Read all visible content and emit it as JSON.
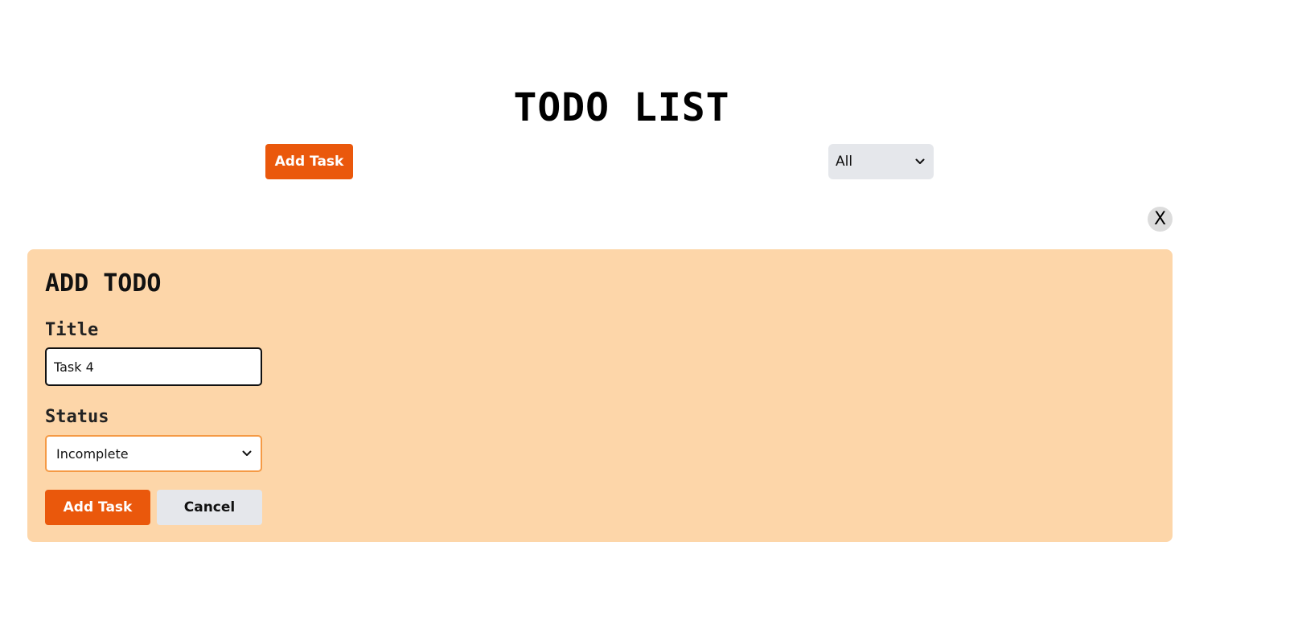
{
  "header": {
    "title": "TODO LIST",
    "add_button_label": "Add Task",
    "filter": {
      "selected": "All",
      "options": [
        "All"
      ]
    }
  },
  "modal": {
    "close_label": "X",
    "title": "ADD TODO",
    "title_field": {
      "label": "Title",
      "value": "Task 4"
    },
    "status_field": {
      "label": "Status",
      "selected": "Incomplete",
      "options": [
        "Incomplete"
      ]
    },
    "submit_label": "Add Task",
    "cancel_label": "Cancel"
  },
  "colors": {
    "primary": "#ea580c",
    "secondary": "#e5e7eb",
    "modal_background": "#fdd6a9",
    "status_border": "#f59a45"
  },
  "icons": {
    "select_arrow": "chevron-down-icon"
  }
}
